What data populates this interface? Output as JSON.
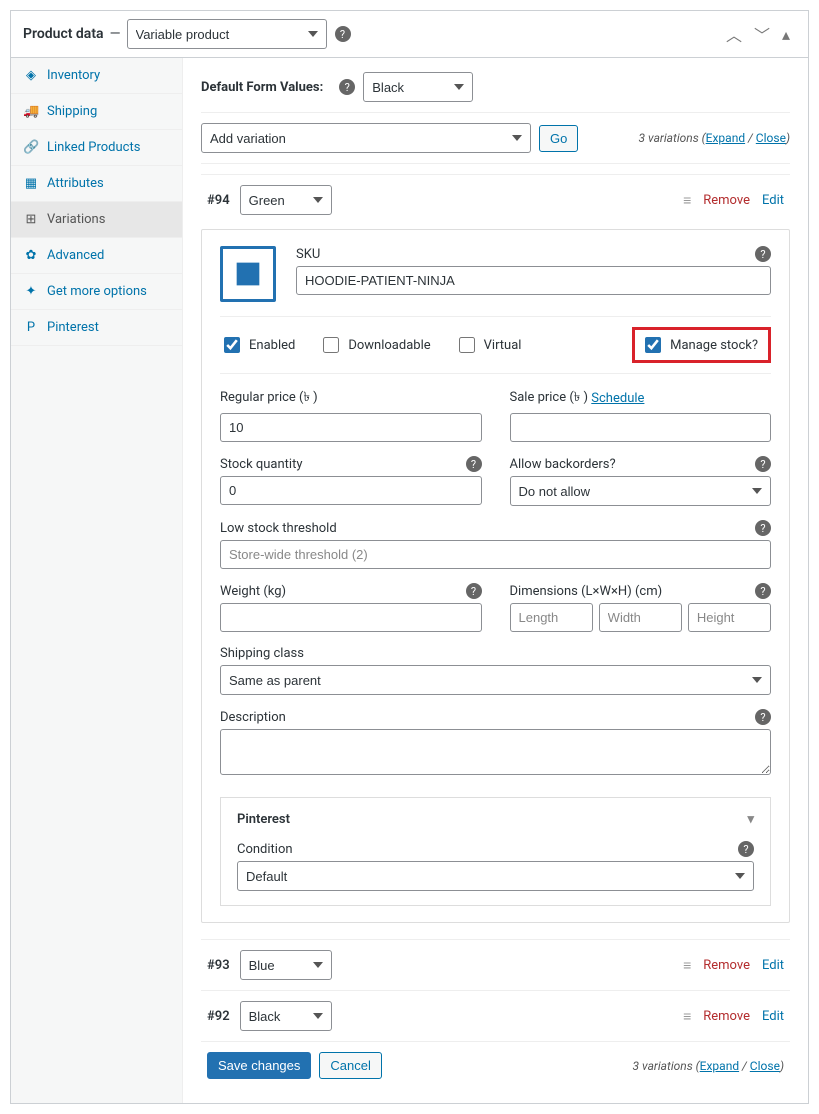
{
  "header": {
    "title": "Product data",
    "dash": "—",
    "product_type": "Variable product"
  },
  "tabs": [
    {
      "icon": "◈",
      "label": "Inventory"
    },
    {
      "icon": "🚚",
      "label": "Shipping"
    },
    {
      "icon": "🔗",
      "label": "Linked Products"
    },
    {
      "icon": "▦",
      "label": "Attributes"
    },
    {
      "icon": "⊞",
      "label": "Variations",
      "active": true
    },
    {
      "icon": "✿",
      "label": "Advanced"
    },
    {
      "icon": "✦",
      "label": "Get more options"
    },
    {
      "icon": "P",
      "label": "Pinterest"
    }
  ],
  "defaults": {
    "label": "Default Form Values:",
    "value": "Black"
  },
  "toolbar": {
    "add_variation": "Add variation",
    "go": "Go",
    "summary": "3 variations",
    "expand": "Expand",
    "close": "Close",
    "open_paren": " (",
    "slash": " / ",
    "close_paren": ")"
  },
  "variations": [
    {
      "id": "#94",
      "attr": "Green",
      "sku": {
        "label": "SKU",
        "value": "HOODIE-PATIENT-NINJA"
      },
      "checks": {
        "enabled": {
          "label": "Enabled",
          "checked": true
        },
        "downloadable": {
          "label": "Downloadable",
          "checked": false
        },
        "virtual": {
          "label": "Virtual",
          "checked": false
        },
        "manage_stock": {
          "label": "Manage stock?",
          "checked": true
        }
      },
      "price": {
        "regular_label": "Regular price (৳ )",
        "regular_value": "10",
        "sale_label": "Sale price (৳ )",
        "schedule": "Schedule",
        "sale_value": ""
      },
      "stock": {
        "qty_label": "Stock quantity",
        "qty_value": "0",
        "backorder_label": "Allow backorders?",
        "backorder_value": "Do not allow",
        "low_label": "Low stock threshold",
        "low_placeholder": "Store-wide threshold (2)"
      },
      "shipping": {
        "weight_label": "Weight (kg)",
        "weight_value": "",
        "dims_label": "Dimensions (L×W×H) (cm)",
        "length_ph": "Length",
        "width_ph": "Width",
        "height_ph": "Height",
        "class_label": "Shipping class",
        "class_value": "Same as parent"
      },
      "description": {
        "label": "Description",
        "value": ""
      },
      "pinterest": {
        "title": "Pinterest",
        "condition_label": "Condition",
        "condition_value": "Default"
      }
    },
    {
      "id": "#93",
      "attr": "Blue"
    },
    {
      "id": "#92",
      "attr": "Black"
    }
  ],
  "actions": {
    "remove": "Remove",
    "edit": "Edit",
    "drag": "≡"
  },
  "footer": {
    "save": "Save changes",
    "cancel": "Cancel"
  }
}
